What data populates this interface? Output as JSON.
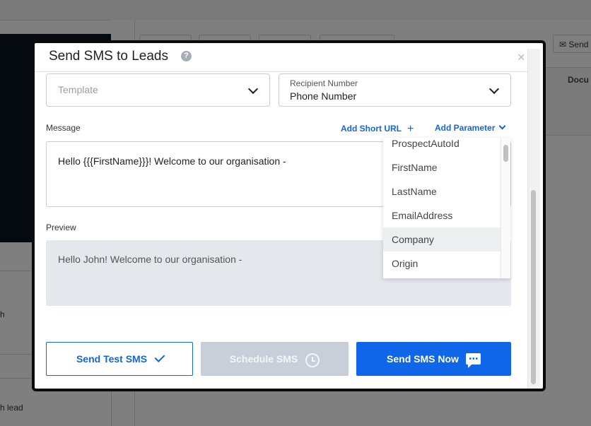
{
  "background": {
    "send_button_partial": "Send",
    "column_partial": "Docu",
    "left_fragment_h": "h",
    "left_fragment_lead": "h lead"
  },
  "modal": {
    "title": "Send SMS to Leads",
    "help": "?",
    "close": "×",
    "template_placeholder": "Template",
    "recipient_label": "Recipient Number",
    "recipient_value": "Phone Number",
    "message_label": "Message",
    "add_short_url": "Add Short URL",
    "add_parameter": "Add Parameter",
    "message_text": "Hello {{{FirstName}}}! Welcome to our organisation -",
    "preview_label": "Preview",
    "preview_text": "Hello John! Welcome to our organisation -",
    "parameters": [
      "ProspectAutoId",
      "FirstName",
      "LastName",
      "EmailAddress",
      "Company",
      "Origin"
    ],
    "highlighted_parameter": "Company",
    "buttons": {
      "send_test": "Send Test SMS",
      "schedule": "Schedule SMS",
      "send_now": "Send SMS Now"
    }
  },
  "colors": {
    "accent": "#1066e8",
    "disabled": "#c8cfd8",
    "preview_bg": "#e4e7eb"
  }
}
